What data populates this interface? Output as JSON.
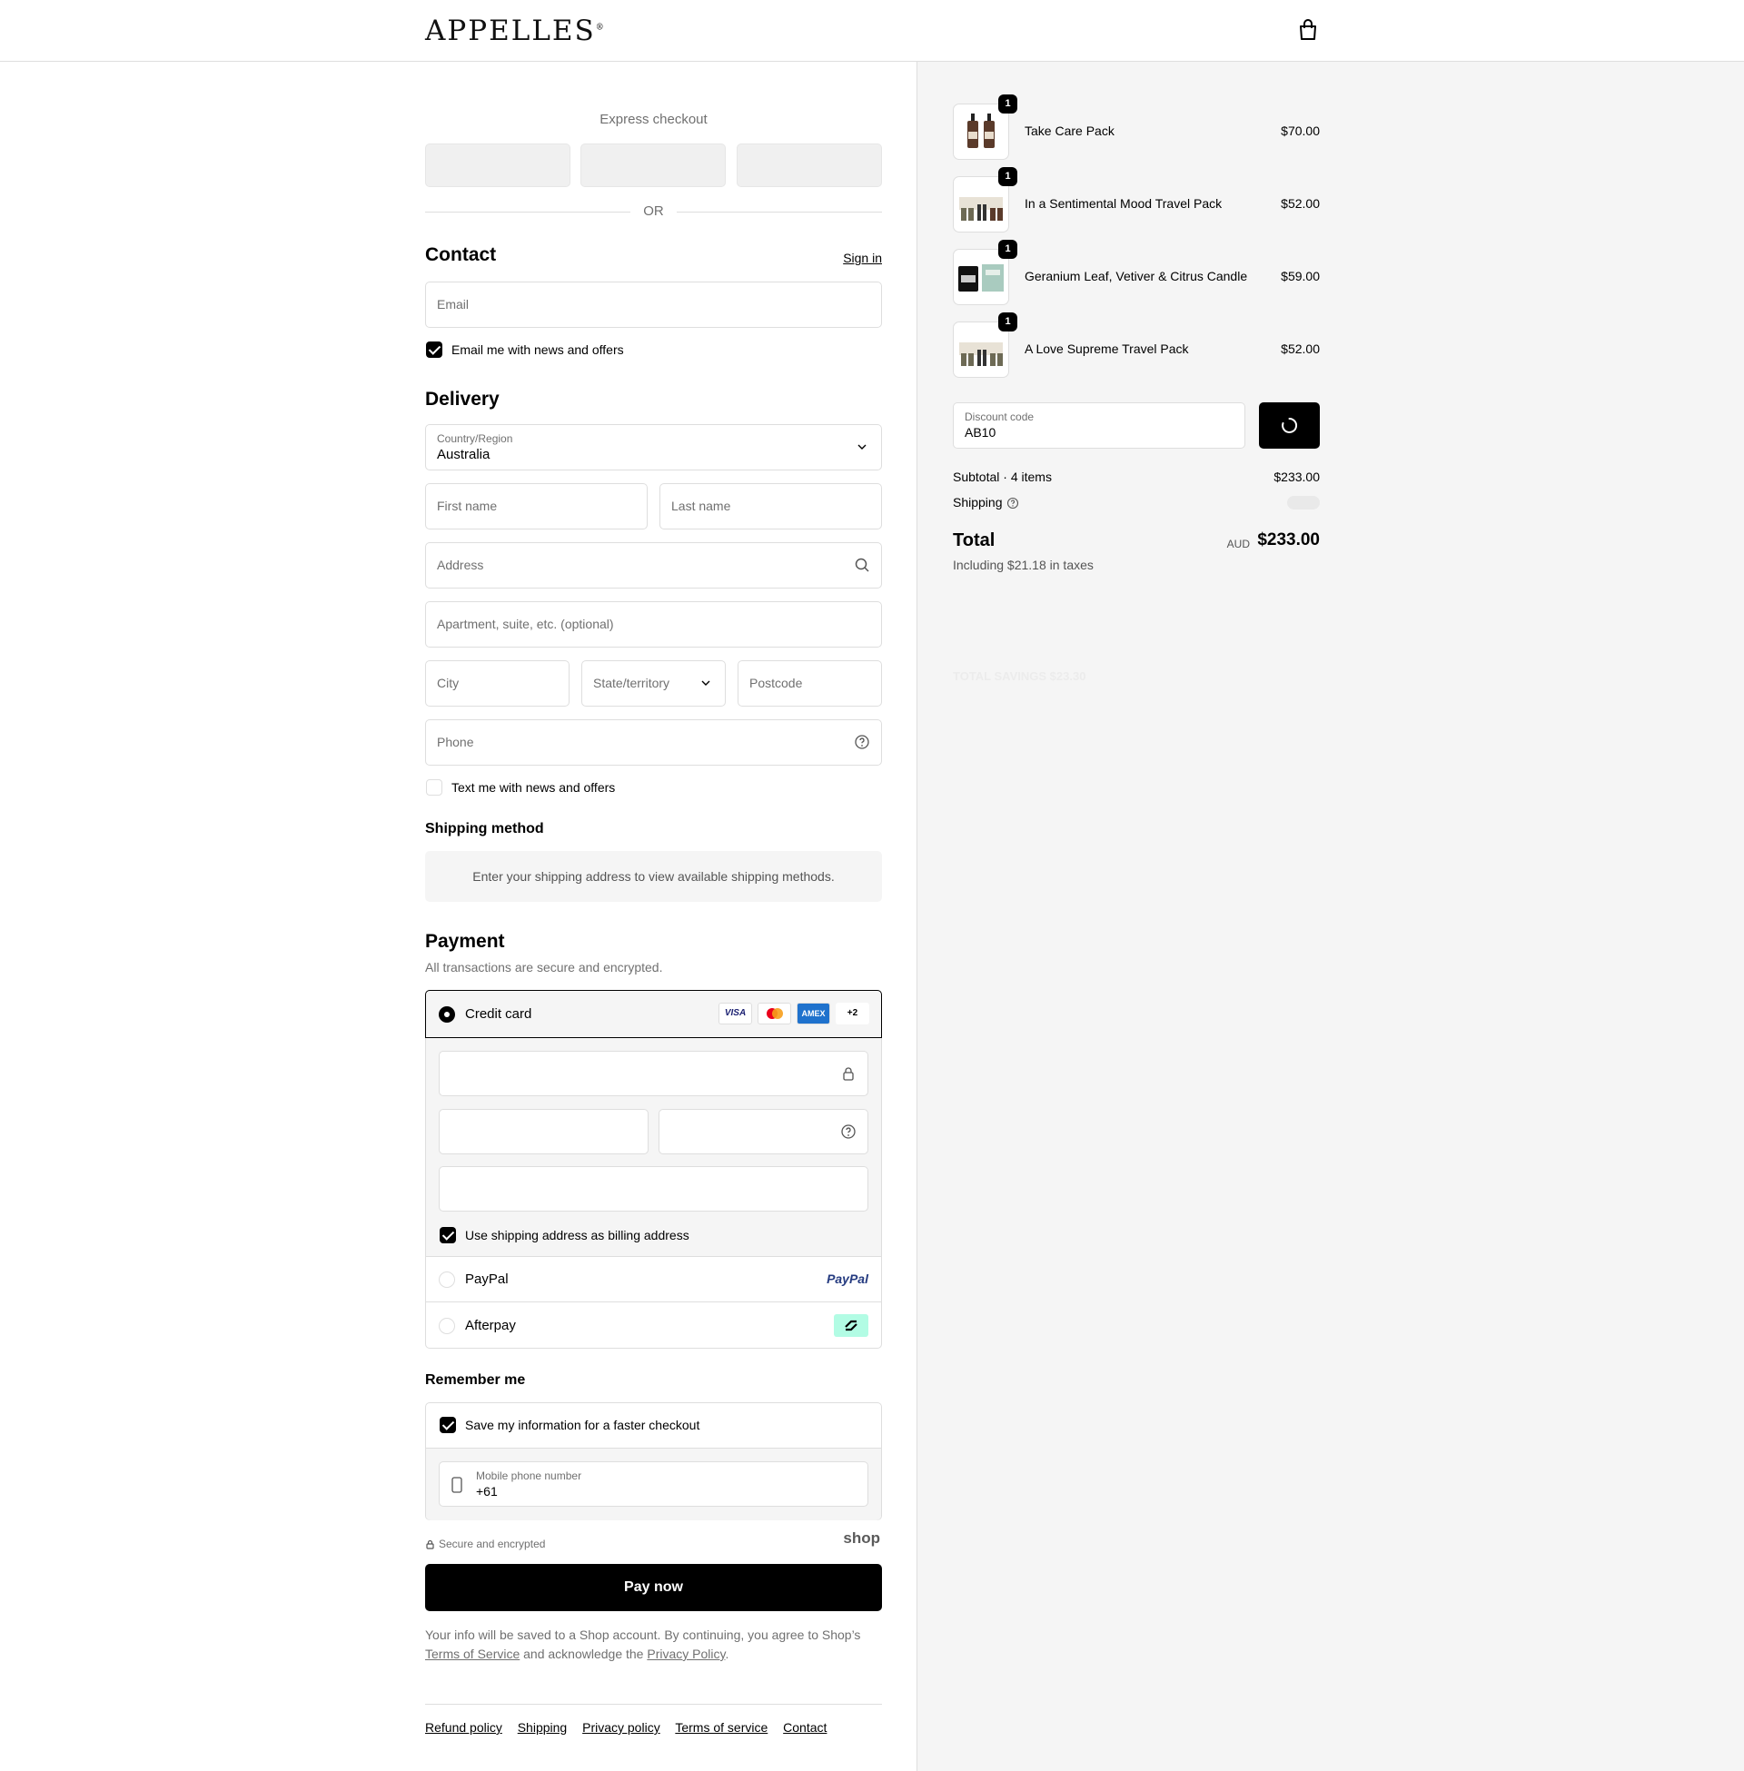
{
  "header": {
    "brand": "APPELLES",
    "brand_mark": "®"
  },
  "express": {
    "label": "Express checkout",
    "or": "OR"
  },
  "contact": {
    "title": "Contact",
    "sign_in": "Sign in",
    "email_placeholder": "Email",
    "news_label": "Email me with news and offers",
    "news_checked": true
  },
  "delivery": {
    "title": "Delivery",
    "country_label": "Country/Region",
    "country_value": "Australia",
    "first_name": "First name",
    "last_name": "Last name",
    "address": "Address",
    "apartment": "Apartment, suite, etc. (optional)",
    "city": "City",
    "state": "State/territory",
    "postcode": "Postcode",
    "phone": "Phone",
    "text_label": "Text me with news and offers",
    "text_checked": false
  },
  "shipping_method": {
    "title": "Shipping method",
    "message": "Enter your shipping address to view available shipping methods."
  },
  "payment": {
    "title": "Payment",
    "subtitle": "All transactions are secure and encrypted.",
    "credit_card": "Credit card",
    "card_badges": [
      "VISA",
      "",
      "AMEX",
      "+2"
    ],
    "billing_label": "Use shipping address as billing address",
    "paypal": "PayPal",
    "paypal_logo": "PayPal",
    "afterpay": "Afterpay"
  },
  "remember": {
    "title": "Remember me",
    "save_label": "Save my information for a faster checkout",
    "mobile_label": "Mobile phone number",
    "mobile_value": "+61",
    "secure": "Secure and encrypted",
    "shop_logo": "shop"
  },
  "pay_now": "Pay now",
  "legal": {
    "text1": "Your info will be saved to a Shop account. By continuing, you agree to Shop’s",
    "terms": "Terms of Service",
    "text2": "and acknowledge the",
    "privacy": "Privacy Policy",
    "text3": "."
  },
  "footer_links": [
    "Refund policy",
    "Shipping",
    "Privacy policy",
    "Terms of service",
    "Contact"
  ],
  "order": {
    "items": [
      {
        "name": "Take Care Pack",
        "price": "$70.00",
        "qty": "1"
      },
      {
        "name": "In a Sentimental Mood Travel Pack",
        "price": "$52.00",
        "qty": "1"
      },
      {
        "name": "Geranium Leaf, Vetiver & Citrus Candle",
        "price": "$59.00",
        "qty": "1"
      },
      {
        "name": "A Love Supreme Travel Pack",
        "price": "$52.00",
        "qty": "1"
      }
    ],
    "discount_label": "Discount code",
    "discount_value": "AB10",
    "subtotal_label": "Subtotal · 4 items",
    "subtotal_value": "$233.00",
    "shipping_label": "Shipping",
    "total_label": "Total",
    "currency": "AUD",
    "total_value": "$233.00",
    "tax_note": "Including $21.18 in taxes",
    "ghost_savings": "TOTAL SAVINGS  $23.30"
  },
  "colors": {
    "accent": "#000000",
    "panel": "#f5f5f5",
    "border": "#dedede",
    "afterpay": "#b2fce4",
    "paypal_blue": "#253b80",
    "paypal_light": "#179bd7"
  }
}
